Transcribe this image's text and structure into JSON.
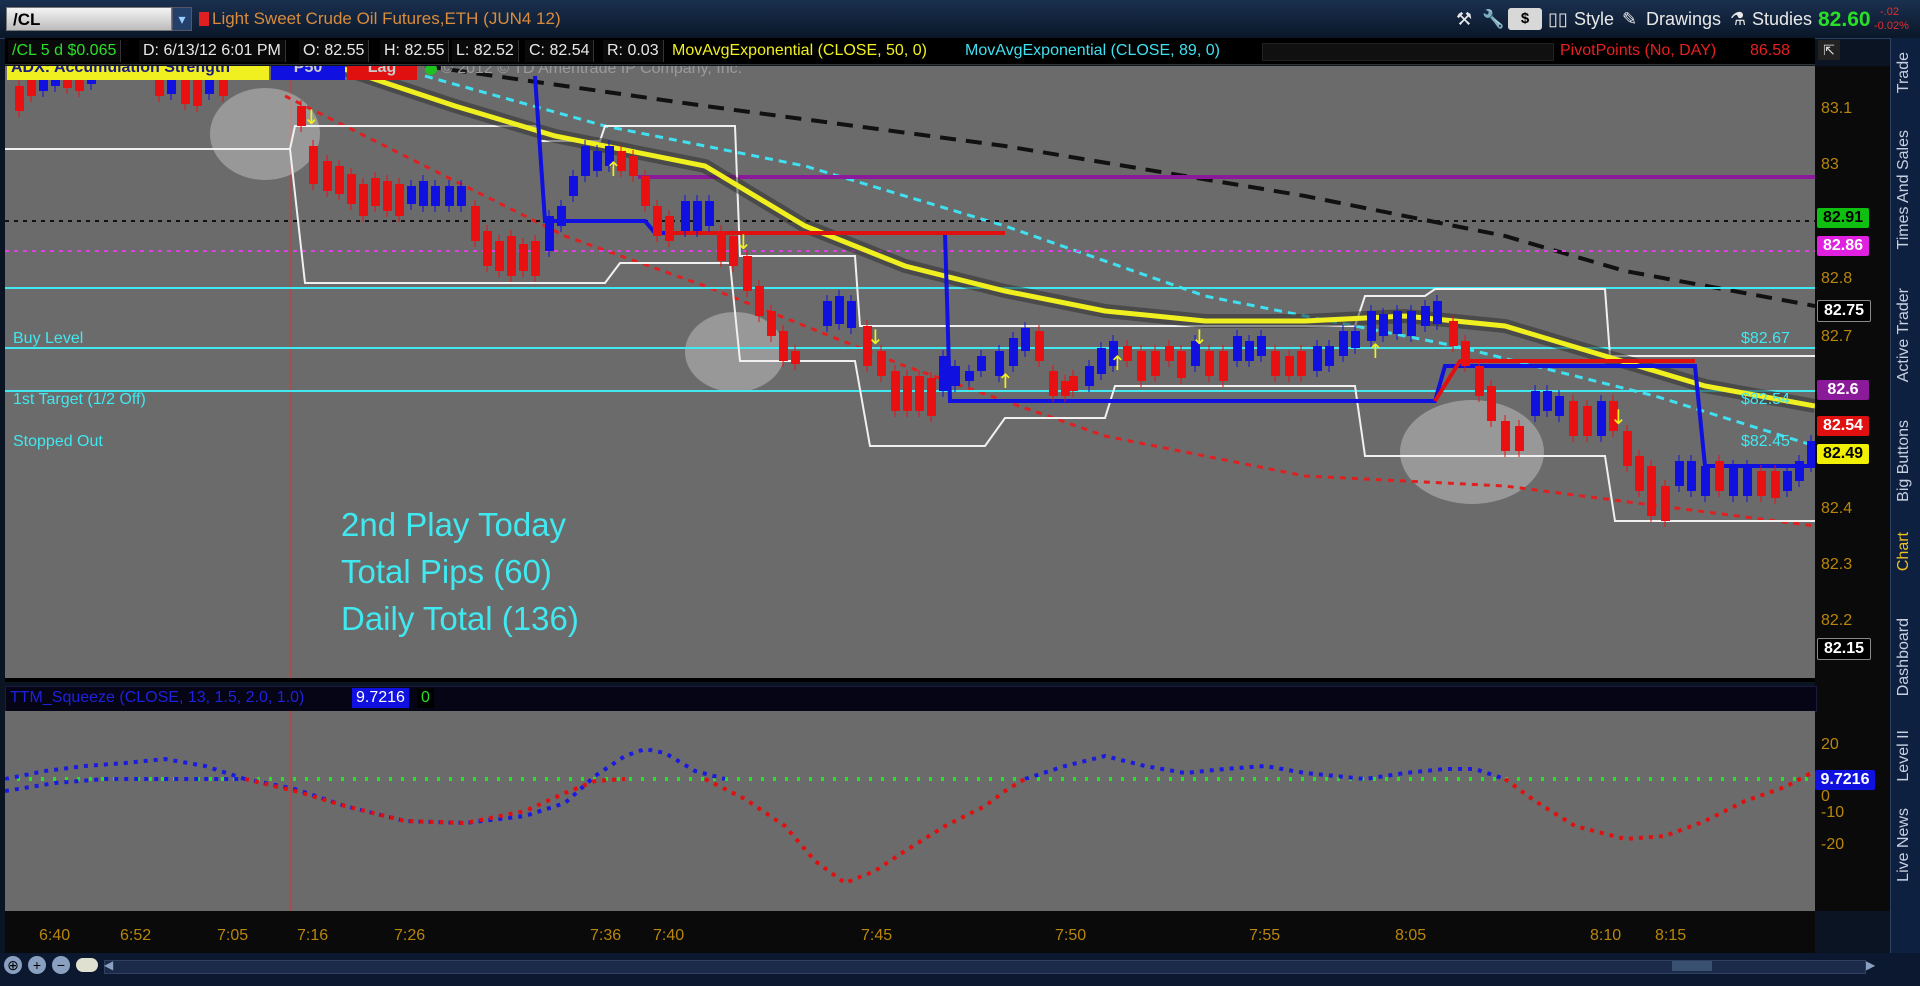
{
  "toolbar": {
    "symbol": "/CL",
    "title": "Light Sweet Crude Oil Futures,ETH (JUN4 12)",
    "dollar_label": "$",
    "style_label": "Style",
    "drawings_label": "Drawings",
    "studies_label": "Studies",
    "last_price": "82.60",
    "change_1": "-.02",
    "change_2": "-0.02%"
  },
  "infobar": {
    "interval": "/CL 5 d $0.065",
    "date": "D: 6/13/12 6:01 PM",
    "open": "O: 82.55",
    "high": "H: 82.55",
    "low": "L: 82.52",
    "close": "C: 82.54",
    "range": "R: 0.03",
    "ema50": "MovAvgExponential (CLOSE, 50, 0)",
    "ema89": "MovAvgExponential (CLOSE, 89, 0)",
    "pivot": "PivotPoints (No, DAY)",
    "pivot_value": "86.58"
  },
  "overlay": {
    "adx_label": "ADX:  Accumulation Strength",
    "p50": "P50",
    "lag": "Lag",
    "copyright": "© 2012 © TD Ameritrade IP Company, Inc.",
    "buy_level": "Buy Level",
    "first_target": "1st Target (1/2 Off)",
    "stopped_out": "Stopped Out",
    "buy_price": "$82.67",
    "target_price": "$82.54",
    "stop_price": "$82.45",
    "play_line1": "2nd Play Today",
    "play_line2": "Total Pips (60)",
    "play_line3": "Daily Total (136)"
  },
  "price_axis": {
    "ticks": [
      "83.1",
      "83",
      "82.8",
      "82.7",
      "82.4",
      "82.3",
      "82.2"
    ],
    "labels": [
      {
        "text": "82.91",
        "bg": "#10c010",
        "fg": "#000000"
      },
      {
        "text": "82.86",
        "bg": "#e020e0",
        "fg": "#ffffff"
      },
      {
        "text": "82.75",
        "bg": "#000000",
        "fg": "#ffffff"
      },
      {
        "text": "82.6",
        "bg": "#8a1a9a",
        "fg": "#ffffff"
      },
      {
        "text": "82.54",
        "bg": "#e01010",
        "fg": "#ffffff"
      },
      {
        "text": "82.49",
        "bg": "#f0f000",
        "fg": "#000000"
      },
      {
        "text": "82.15",
        "bg": "#000000",
        "fg": "#ffffff"
      }
    ]
  },
  "ttm": {
    "label": "TTM_Squeeze (CLOSE, 13, 1.5, 2.0, 1.0)",
    "value": "9.7216",
    "alert": "0",
    "ticks": [
      "20",
      "0",
      "-10",
      "-20"
    ],
    "current_label": "9.7216"
  },
  "time_axis": {
    "ticks": [
      "6:40",
      "6:52",
      "7:05",
      "7:16",
      "7:26",
      "7:36",
      "7:40",
      "7:45",
      "7:50",
      "7:55",
      "8:05",
      "8:10",
      "8:15"
    ]
  },
  "side_tabs": [
    "Trade",
    "Times And Sales",
    "Active Trader",
    "Big Buttons",
    "Chart",
    "Dashboard",
    "Level II",
    "Live News"
  ],
  "colors": {
    "bull_candle": "#1010e0",
    "bear_candle": "#e81010",
    "ema50": "#f0f020",
    "ema89": "#40e0f0",
    "cyan_level": "#40e8f0",
    "purple_line": "#8a1a9a"
  }
}
